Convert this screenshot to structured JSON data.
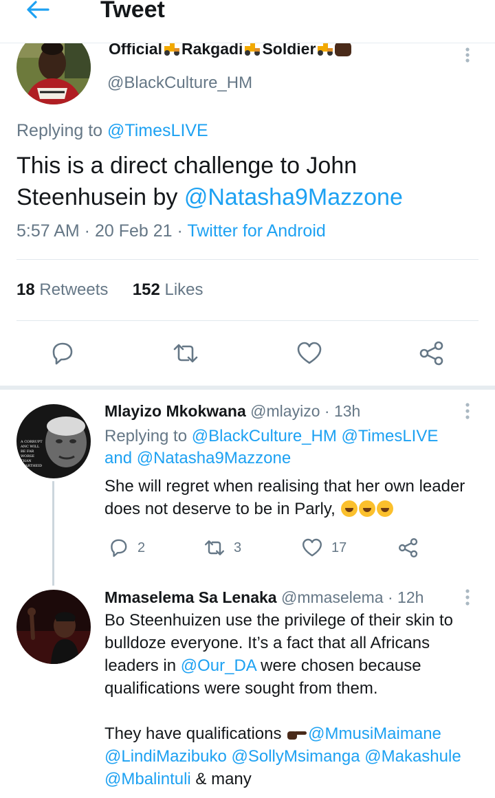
{
  "header": {
    "title": "Tweet"
  },
  "main_tweet": {
    "author_name_prefix": "Official",
    "author_name_mid": "Rakgadi",
    "author_name_suffix": "Soldier",
    "handle": "@BlackCulture_HM",
    "replying_label": "Replying to",
    "replying_to": "@TimesLIVE",
    "text_line1": "This is a direct challenge to John",
    "text_line2": "Steenhusein by ",
    "text_mention": "@Natasha9Mazzone",
    "time": "5:57 AM",
    "date": "20 Feb 21",
    "source": "Twitter for Android",
    "retweets_count": "18",
    "retweets_label": "Retweets",
    "likes_count": "152",
    "likes_label": "Likes"
  },
  "replies": [
    {
      "name": "Mlayizo Mkokwana",
      "handle": "@mlayizo",
      "time": "13h",
      "replying_label": "Replying to",
      "mention1": "@BlackCulture_HM",
      "mention2": "@TimesLIVE",
      "and_label": "and",
      "mention3": "@Natasha9Mazzone",
      "text_line1": "She will regret when realising that her own leader",
      "text_line2": "does not deserve to be in Parly,",
      "reply_count": "2",
      "retweet_count": "3",
      "like_count": "17",
      "avatar_caption": "A CORRUPT ANC WILL BE FAR WORSE THAN APARTHEID"
    },
    {
      "name": "Mmaselema Sa Lenaka",
      "handle": "@mmaselema",
      "time": "12h",
      "text_line1": "Bo Steenhuizen use the privilege of their skin to",
      "text_line2": "bulldoze everyone. It’s a fact that all Africans",
      "text_line3_pre": "leaders in ",
      "text_line3_mention": "@Our_DA",
      "text_line3_post": " were chosen because",
      "text_line4": "qualifications were sought from them.",
      "text_line5_pre": "They have qualifications ",
      "mention_a": "@MmusiMaimane",
      "mention_b": "@LindiMazibuko",
      "mention_c": "@SollyMsimanga",
      "mention_d": "@Makashule",
      "mention_e": "@Mbalintuli",
      "tail": " & many"
    }
  ],
  "colors": {
    "accent": "#1da1f2",
    "secondary_text": "#657786",
    "divider": "#e1e8ed"
  },
  "icons": [
    "arrow-left-icon",
    "more-vertical-icon",
    "reply-icon",
    "retweet-icon",
    "heart-icon",
    "share-icon",
    "tractor-emoji",
    "fist-emoji",
    "laughing-emoji",
    "pointing-hand-emoji"
  ]
}
